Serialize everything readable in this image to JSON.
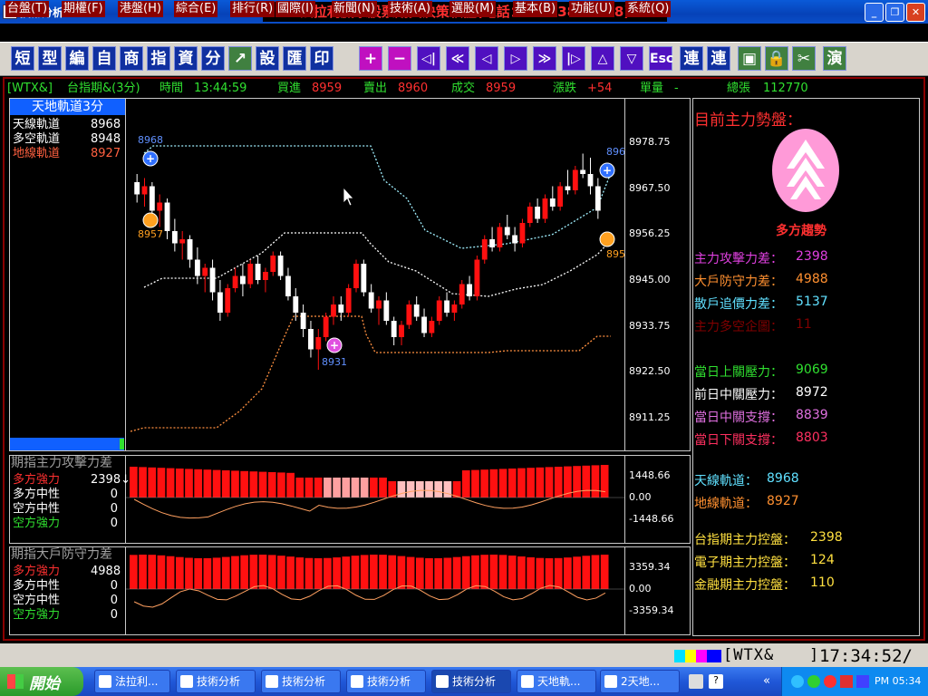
{
  "window": {
    "title": "技術分析",
    "banner": "法拉利贏家股票期貨決策軟體(電話：02-23832828)",
    "controls": [
      "_",
      "❐",
      "✕"
    ]
  },
  "menu": [
    "台盤(T)",
    "期權(F)",
    "港盤(H)",
    "綜合(E)",
    "排行(R)",
    "國際(I)",
    "新聞(N)",
    "技術(A)",
    "選股(M)",
    "基本(B)",
    "功能(U)",
    "系統(Q)"
  ],
  "toolbar": {
    "text_buttons": [
      "短",
      "型",
      "編",
      "自",
      "商",
      "指",
      "資",
      "分"
    ],
    "text_buttons2": [
      "設",
      "匯",
      "印"
    ],
    "right_buttons": [
      "連",
      "連"
    ],
    "last_button": "演"
  },
  "infobar": {
    "symbol": "[WTX&]",
    "name": "台指期&(3分)",
    "time_label": "時間",
    "time": "13:44:59",
    "bid_label": "買進",
    "bid": "8959",
    "ask_label": "賣出",
    "ask": "8960",
    "trade_label": "成交",
    "trade": "8959",
    "change_label": "漲跌",
    "change": "+54",
    "volume_label": "單量",
    "volume": "-",
    "total_label": "總張",
    "total": "112770"
  },
  "main_chart": {
    "title": "天地軌道3分",
    "legend": [
      {
        "label": "天線軌道",
        "value": "8968",
        "color": "#ffffff"
      },
      {
        "label": "多空軌道",
        "value": "8948",
        "color": "#ffffff"
      },
      {
        "label": "地線軌道",
        "value": "8927",
        "color": "#ff6040"
      }
    ],
    "y_ticks": [
      "8978.75",
      "8967.50",
      "8956.25",
      "8945.00",
      "8933.75",
      "8922.50",
      "8911.25"
    ],
    "annotations": [
      "8968",
      "8957",
      "8931",
      "896",
      "895"
    ]
  },
  "chart_data": {
    "type": "candlestick",
    "title": "天地軌道3分",
    "ylim": [
      8905,
      8985
    ],
    "y_ticks": [
      8978.75,
      8967.5,
      8956.25,
      8945.0,
      8933.75,
      8922.5,
      8911.25
    ],
    "series": [
      {
        "name": "天線軌道",
        "last": 8968
      },
      {
        "name": "多空軌道",
        "last": 8948
      },
      {
        "name": "地線軌道",
        "last": 8927
      }
    ],
    "candles": [
      [
        8969,
        8971,
        8964,
        8966
      ],
      [
        8966,
        8970,
        8963,
        8968
      ],
      [
        8968,
        8969,
        8960,
        8962
      ],
      [
        8962,
        8966,
        8958,
        8964
      ],
      [
        8964,
        8965,
        8955,
        8957
      ],
      [
        8957,
        8960,
        8952,
        8954
      ],
      [
        8954,
        8957,
        8950,
        8955
      ],
      [
        8955,
        8956,
        8948,
        8950
      ],
      [
        8950,
        8953,
        8944,
        8946
      ],
      [
        8946,
        8949,
        8942,
        8948
      ],
      [
        8948,
        8950,
        8940,
        8942
      ],
      [
        8942,
        8945,
        8935,
        8937
      ],
      [
        8937,
        8944,
        8936,
        8943
      ],
      [
        8943,
        8948,
        8942,
        8946
      ],
      [
        8946,
        8949,
        8941,
        8944
      ],
      [
        8944,
        8950,
        8943,
        8949
      ],
      [
        8949,
        8951,
        8944,
        8945
      ],
      [
        8945,
        8948,
        8942,
        8947
      ],
      [
        8947,
        8952,
        8946,
        8951
      ],
      [
        8951,
        8952,
        8945,
        8946
      ],
      [
        8946,
        8948,
        8940,
        8941
      ],
      [
        8941,
        8943,
        8935,
        8937
      ],
      [
        8937,
        8939,
        8931,
        8933
      ],
      [
        8933,
        8935,
        8926,
        8928
      ],
      [
        8928,
        8933,
        8923,
        8931
      ],
      [
        8931,
        8937,
        8930,
        8936
      ],
      [
        8936,
        8941,
        8934,
        8939
      ],
      [
        8939,
        8941,
        8935,
        8937
      ],
      [
        8937,
        8944,
        8936,
        8943
      ],
      [
        8943,
        8950,
        8942,
        8949
      ],
      [
        8949,
        8950,
        8941,
        8942
      ],
      [
        8942,
        8944,
        8937,
        8938
      ],
      [
        8938,
        8941,
        8934,
        8940
      ],
      [
        8940,
        8942,
        8934,
        8935
      ],
      [
        8935,
        8936,
        8929,
        8931
      ],
      [
        8931,
        8935,
        8929,
        8934
      ],
      [
        8934,
        8940,
        8933,
        8939
      ],
      [
        8939,
        8941,
        8935,
        8936
      ],
      [
        8936,
        8938,
        8931,
        8932
      ],
      [
        8932,
        8936,
        8931,
        8935
      ],
      [
        8935,
        8941,
        8934,
        8940
      ],
      [
        8940,
        8942,
        8936,
        8937
      ],
      [
        8937,
        8940,
        8935,
        8939
      ],
      [
        8939,
        8945,
        8938,
        8944
      ],
      [
        8944,
        8946,
        8940,
        8941
      ],
      [
        8941,
        8951,
        8940,
        8950
      ],
      [
        8950,
        8956,
        8949,
        8955
      ],
      [
        8955,
        8958,
        8952,
        8953
      ],
      [
        8953,
        8959,
        8952,
        8958
      ],
      [
        8958,
        8961,
        8955,
        8956
      ],
      [
        8956,
        8958,
        8952,
        8954
      ],
      [
        8954,
        8960,
        8953,
        8959
      ],
      [
        8959,
        8964,
        8958,
        8963
      ],
      [
        8963,
        8965,
        8959,
        8960
      ],
      [
        8960,
        8966,
        8959,
        8965
      ],
      [
        8965,
        8968,
        8962,
        8963
      ],
      [
        8963,
        8969,
        8962,
        8968
      ],
      [
        8968,
        8972,
        8966,
        8967
      ],
      [
        8967,
        8973,
        8966,
        8972
      ],
      [
        8972,
        8976,
        8970,
        8971
      ],
      [
        8971,
        8975,
        8966,
        8968
      ],
      [
        8968,
        8970,
        8960,
        8962
      ]
    ]
  },
  "sub1": {
    "title": "期指主力攻擊力差",
    "rows": [
      {
        "label": "多方強力",
        "value": "2398↓",
        "color": "#ff3030"
      },
      {
        "label": "多方中性",
        "value": "0",
        "color": "#ffffff"
      },
      {
        "label": "空方中性",
        "value": "0",
        "color": "#ffffff"
      },
      {
        "label": "空方強力",
        "value": "0",
        "color": "#30e030"
      }
    ],
    "y_ticks": [
      "1448.66",
      "0.00",
      "-1448.66"
    ]
  },
  "sub2": {
    "title": "期指大戶防守力差",
    "rows": [
      {
        "label": "多方強力",
        "value": "4988",
        "color": "#ff3030"
      },
      {
        "label": "多方中性",
        "value": "0",
        "color": "#ffffff"
      },
      {
        "label": "空方中性",
        "value": "0",
        "color": "#ffffff"
      },
      {
        "label": "空方強力",
        "value": "0",
        "color": "#30e030"
      }
    ],
    "y_ticks": [
      "3359.34",
      "0.00",
      "-3359.34"
    ]
  },
  "right_panel": {
    "title": "目前主力勢盤：",
    "trend": "多方趨勢",
    "metrics": [
      {
        "label": "主力攻擊力差：",
        "value": "2398",
        "color": "#e040e0"
      },
      {
        "label": "大戶防守力差：",
        "value": "4988",
        "color": "#ff9030"
      },
      {
        "label": "散戶追價力差：",
        "value": "5137",
        "color": "#60e0ff"
      },
      {
        "label": "主力多空企圖：",
        "value": "11",
        "color": "#800000"
      }
    ],
    "levels": [
      {
        "label": "當日上關壓力：",
        "value": "9069",
        "color": "#30e030"
      },
      {
        "label": "前日中關壓力：",
        "value": "8972",
        "color": "#ffffff"
      },
      {
        "label": "當日中關支撐：",
        "value": "8839",
        "color": "#e070e0"
      },
      {
        "label": "當日下關支撐：",
        "value": "8803",
        "color": "#ff3060"
      }
    ],
    "orbits": [
      {
        "label": "天線軌道：",
        "value": "8968",
        "color": "#60e0ff"
      },
      {
        "label": "地線軌道：",
        "value": "8927",
        "color": "#ff9030"
      }
    ],
    "control": [
      {
        "label": "台指期主力控盤：",
        "value": "2398",
        "color": "#ffe040"
      },
      {
        "label": "電子期主力控盤：",
        "value": "124",
        "color": "#ffe040"
      },
      {
        "label": "金融期主力控盤：",
        "value": "110",
        "color": "#ffe040"
      }
    ]
  },
  "statusbar": {
    "symbol": "[WTX&",
    "bracket": "]",
    "clock": "17:34:52/"
  },
  "taskbar": {
    "start": "開始",
    "tasks": [
      "法拉利...",
      "技術分析",
      "技術分析",
      "技術分析",
      "技術分析",
      "天地軌...",
      "2天地..."
    ],
    "clock": "PM 05:34"
  },
  "colors": {
    "up": "#ff1010",
    "down": "#ffffff",
    "sky": "#a0f0ff",
    "mid": "#ffffff",
    "ground": "#ff9040"
  }
}
